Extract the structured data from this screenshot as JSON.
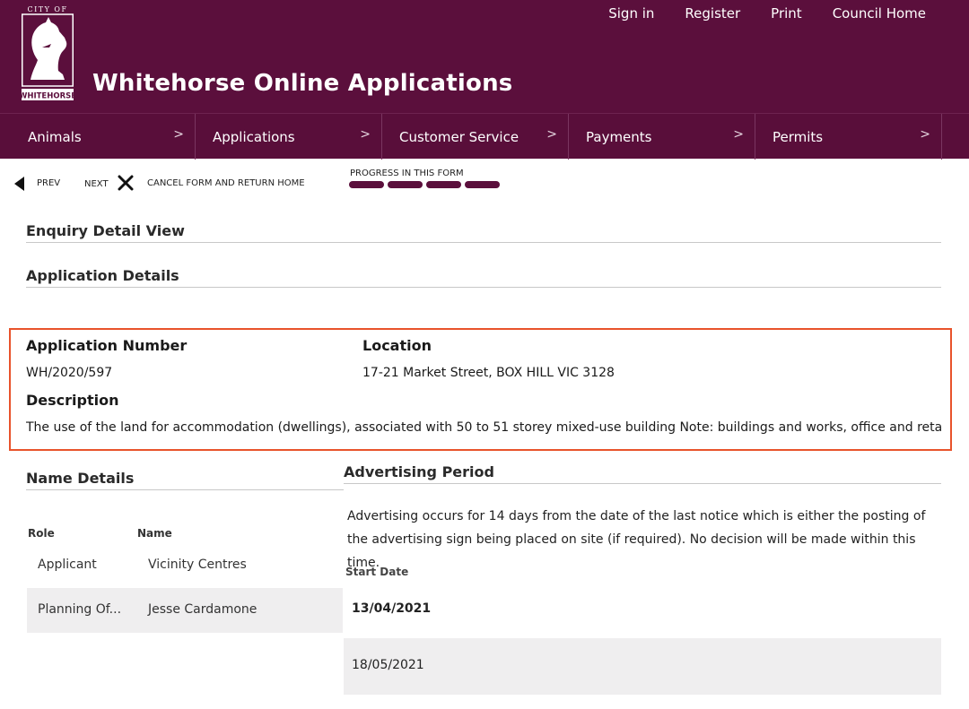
{
  "header": {
    "logo_city": "CITY OF",
    "logo_name": "WHITEHORSE",
    "title": "Whitehorse Online Applications",
    "links": [
      "Sign in",
      "Register",
      "Print",
      "Council Home"
    ]
  },
  "nav": {
    "items": [
      "Animals",
      "Applications",
      "Customer Service",
      "Payments",
      "Permits"
    ],
    "chevron": ">"
  },
  "toolbar": {
    "prev": "PREV",
    "next": "NEXT",
    "cancel": "CANCEL FORM AND RETURN HOME",
    "progress_label": "PROGRESS IN THIS FORM",
    "progress": {
      "completed": 4,
      "total": 4
    }
  },
  "sections": {
    "enquiry": "Enquiry Detail View",
    "application": "Application Details",
    "names": "Name Details",
    "advertising": "Advertising Period"
  },
  "application": {
    "number_label": "Application Number",
    "number": "WH/2020/597",
    "location_label": "Location",
    "location": "17-21 Market Street, BOX HILL VIC 3128",
    "description_label": "Description",
    "description": "The use of the land for accommodation (dwellings), associated with 50 to 51 storey mixed-use building Note: buildings and works, office and retail l"
  },
  "names": {
    "columns": [
      "Role",
      "Name"
    ],
    "rows": [
      {
        "role": "Applicant",
        "name": "Vicinity Centres"
      },
      {
        "role": "Planning Of...",
        "name": "Jesse Cardamone"
      }
    ]
  },
  "advertising": {
    "text": "Advertising occurs for 14 days from the date of the last notice which is either the posting of the advertising sign being placed on site (if required). No decision will be made within this time.",
    "start_label": "Start Date",
    "dates": [
      "13/04/2021",
      "18/05/2021"
    ]
  },
  "colors": {
    "brand": "#5b0f3c",
    "highlight": "#e8532b"
  }
}
